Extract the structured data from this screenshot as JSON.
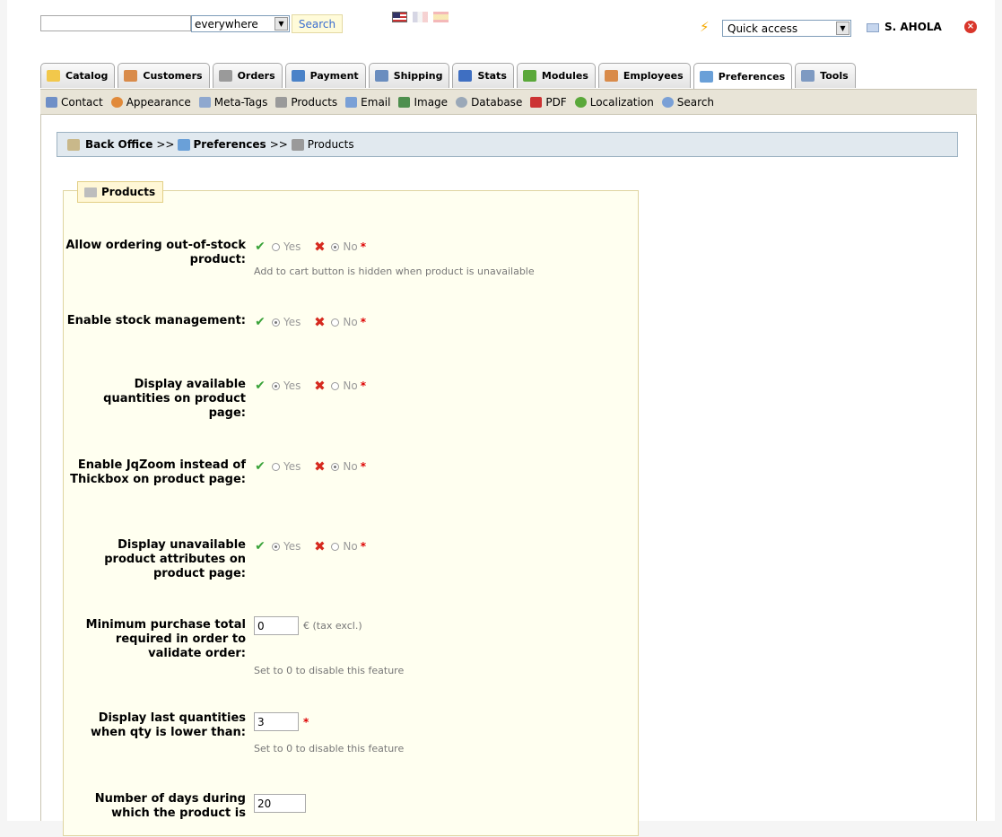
{
  "header": {
    "search_value": "",
    "search_scope": "everywhere",
    "search_button": "Search",
    "quick_access": "Quick access",
    "user_name": "S. AHOLA"
  },
  "tabs": [
    {
      "label": "Catalog",
      "icon": "folder-icon",
      "color": "#f2c84b"
    },
    {
      "label": "Customers",
      "icon": "customer-icon",
      "color": "#d98b4a"
    },
    {
      "label": "Orders",
      "icon": "cart-icon",
      "color": "#9a9a9a"
    },
    {
      "label": "Payment",
      "icon": "payment-icon",
      "color": "#4a82c8"
    },
    {
      "label": "Shipping",
      "icon": "truck-icon",
      "color": "#6a8dbf"
    },
    {
      "label": "Stats",
      "icon": "chart-icon",
      "color": "#3f6fc2"
    },
    {
      "label": "Modules",
      "icon": "puzzle-icon",
      "color": "#5aa83a"
    },
    {
      "label": "Employees",
      "icon": "employee-icon",
      "color": "#d98b4a"
    },
    {
      "label": "Preferences",
      "icon": "preferences-icon",
      "color": "#6aa0d8"
    },
    {
      "label": "Tools",
      "icon": "wrench-icon",
      "color": "#7e9ac2"
    }
  ],
  "subnav": [
    {
      "label": "Contact",
      "icon": "contact-card-icon",
      "color": "#6f8fc7"
    },
    {
      "label": "Appearance",
      "icon": "palette-icon",
      "color": "#e18a3a"
    },
    {
      "label": "Meta-Tags",
      "icon": "meta-tags-icon",
      "color": "#8fa8cf"
    },
    {
      "label": "Products",
      "icon": "cart-icon",
      "color": "#9a9a9a"
    },
    {
      "label": "Email",
      "icon": "email-icon",
      "color": "#7aa0d6"
    },
    {
      "label": "Image",
      "icon": "image-icon",
      "color": "#4e8f4e"
    },
    {
      "label": "Database",
      "icon": "database-icon",
      "color": "#9aa8b8"
    },
    {
      "label": "PDF",
      "icon": "pdf-icon",
      "color": "#cc3333"
    },
    {
      "label": "Localization",
      "icon": "globe-icon",
      "color": "#5aa83a"
    },
    {
      "label": "Search",
      "icon": "magnifier-icon",
      "color": "#7aa0d6"
    }
  ],
  "breadcrumb": {
    "root": "Back Office",
    "sep1": ">>",
    "section": "Preferences",
    "sep2": ">>",
    "page": "Products"
  },
  "legend": "Products",
  "options": {
    "yes": "Yes",
    "no": "No",
    "required": "*",
    "currency_unit": "€ (tax excl.)"
  },
  "fields": {
    "ordering_out_of_stock": {
      "label": "Allow ordering out-of-stock product:",
      "value": "No",
      "hint": "Add to cart button is hidden when product is unavailable"
    },
    "stock_management": {
      "label": "Enable stock management:",
      "value": "Yes"
    },
    "display_quantities": {
      "label": "Display available quantities on product page:",
      "value": "Yes"
    },
    "jqzoom": {
      "label": "Enable JqZoom instead of Thickbox on product page:",
      "value": "No"
    },
    "unavailable_attributes": {
      "label": "Display unavailable product attributes on product page:",
      "value": "Yes"
    },
    "minimum_purchase": {
      "label": "Minimum purchase total required in order to validate order:",
      "value": "0",
      "hint": "Set to 0 to disable this feature"
    },
    "last_quantities": {
      "label": "Display last quantities when qty is lower than:",
      "value": "3",
      "hint": "Set to 0 to disable this feature"
    },
    "new_days": {
      "label": "Number of days during which the product is",
      "value": "20"
    }
  }
}
